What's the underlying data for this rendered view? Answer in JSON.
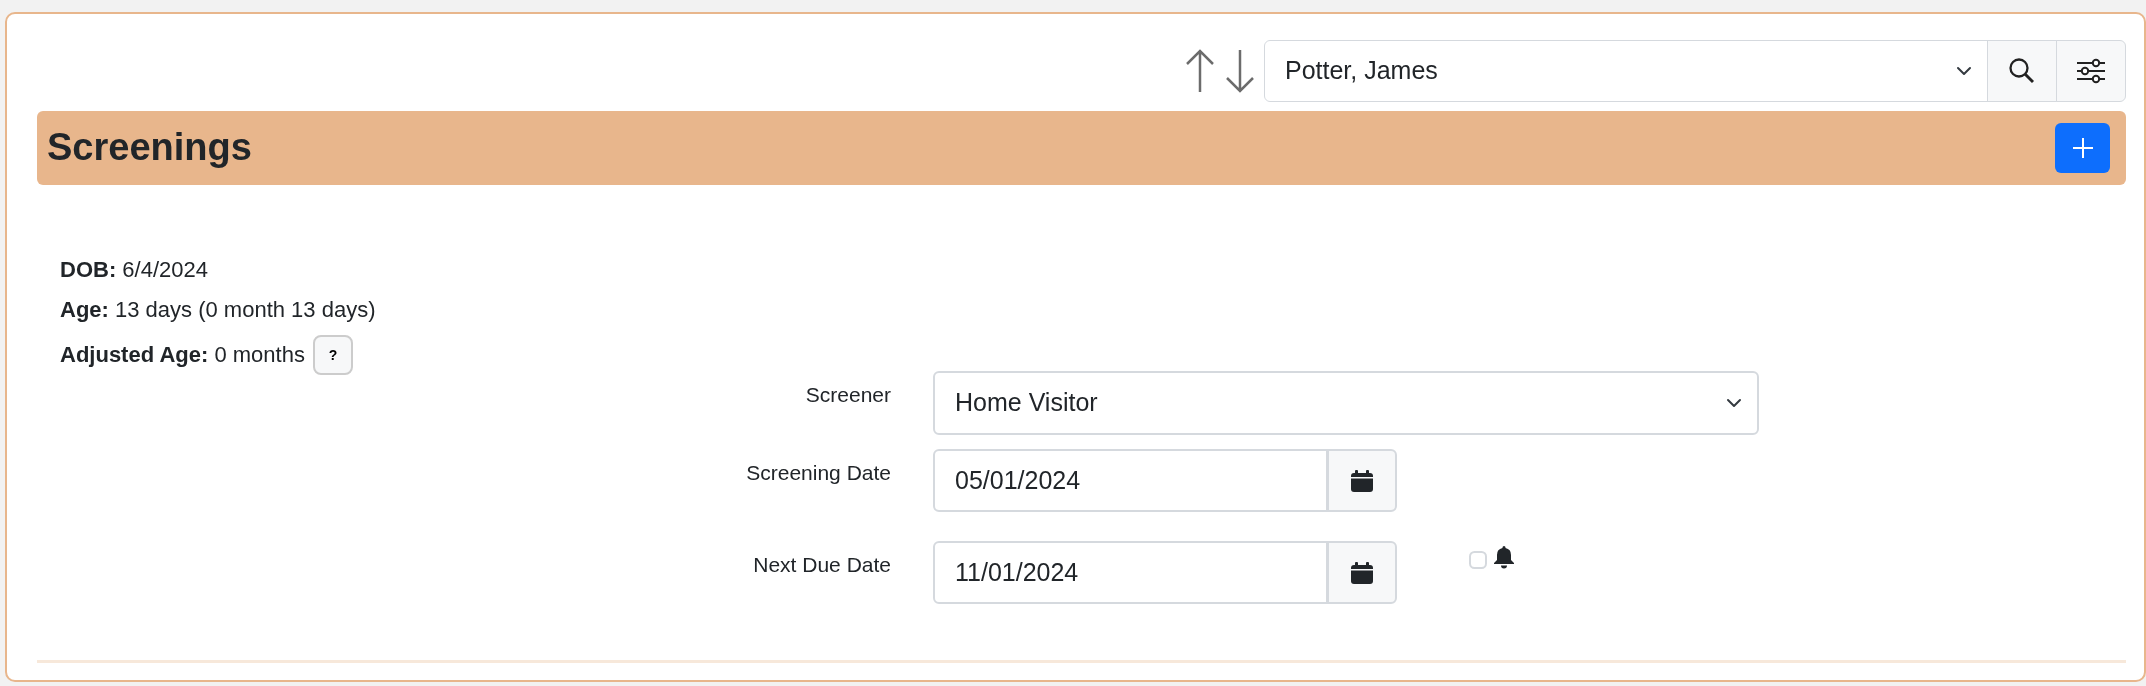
{
  "toolbar": {
    "client_select": {
      "value": "Potter, James"
    }
  },
  "section": {
    "title": "Screenings"
  },
  "child_info": [
    {
      "label": "DOB:",
      "value": "6/4/2024"
    },
    {
      "label": "Age:",
      "value": "13 days (0 month 13 days)"
    },
    {
      "label": "Adjusted Age:",
      "value": "0 months",
      "help": "?"
    }
  ],
  "form": {
    "fields": [
      {
        "kind": "select",
        "label": "Screener",
        "value": "Home Visitor"
      },
      {
        "kind": "date",
        "label": "Screening Date",
        "value": "05/01/2024"
      },
      {
        "kind": "date",
        "label": "Next Due Date",
        "value": "11/01/2024",
        "reminder": {
          "checked": false
        }
      }
    ]
  }
}
